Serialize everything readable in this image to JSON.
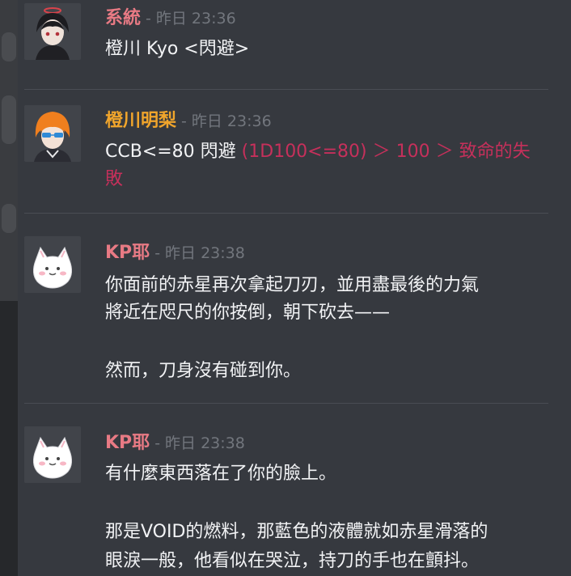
{
  "messages": [
    {
      "username": "系統",
      "username_color": "#e87a84",
      "separator": "-",
      "timestamp": "昨日 23:36",
      "lines": [
        "橙川 Kyo <閃避>"
      ]
    },
    {
      "username": "橙川明梨",
      "username_color": "#f0a52c",
      "separator": "-",
      "timestamp": "昨日 23:36",
      "line1_prefix": "CCB<=80 閃避 ",
      "line1_roll": "(1D100<=80) ＞ 100 ＞ 致命的失",
      "line2_roll": "敗",
      "roll_color": "#c6305b"
    },
    {
      "username": "KP耶",
      "username_color": "#e87a84",
      "separator": "-",
      "timestamp": "昨日 23:38",
      "lines": [
        "你面前的赤星再次拿起刀刃，並用盡最後的力氣",
        "將近在咫尺的你按倒，朝下砍去——",
        "",
        "然而，刀身沒有碰到你。"
      ]
    },
    {
      "username": "KP耶",
      "username_color": "#e87a84",
      "separator": "-",
      "timestamp": "昨日 23:38",
      "lines": [
        "有什麼東西落在了你的臉上。",
        "",
        "那是VOID的燃料，那藍色的液體就如赤星滑落的",
        "眼淚一般，他看似在哭泣，持刀的手也在顫抖。"
      ]
    }
  ],
  "colors": {
    "background": "#36393f",
    "timestamp": "#72767d",
    "text": "#f2f3f5"
  }
}
